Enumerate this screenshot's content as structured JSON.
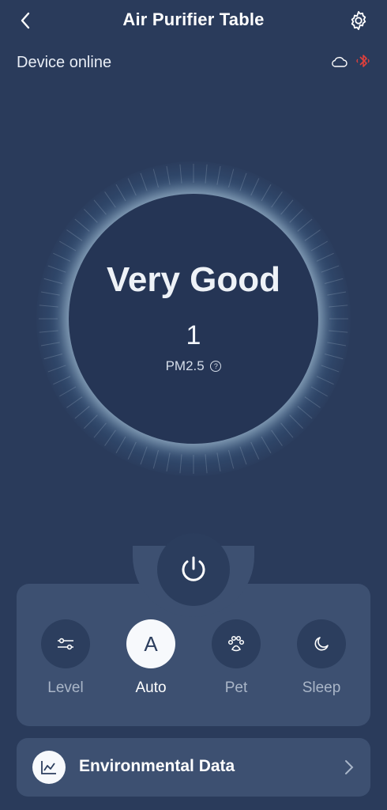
{
  "header": {
    "title": "Air Purifier Table"
  },
  "status": {
    "text": "Device online"
  },
  "gauge": {
    "quality": "Very Good",
    "value": "1",
    "label": "PM2.5",
    "help": "?"
  },
  "modes": [
    {
      "label": "Level",
      "icon": "sliders-icon"
    },
    {
      "label": "Auto",
      "icon": "A",
      "active": true
    },
    {
      "label": "Pet",
      "icon": "paw-icon"
    },
    {
      "label": "Sleep",
      "icon": "moon-icon"
    }
  ],
  "env": {
    "label": "Environmental Data"
  },
  "colors": {
    "background": "#2a3b5b",
    "panel": "#3d5071",
    "accent_glow": "#cfe9f5",
    "bluetooth": "#e0403c"
  }
}
